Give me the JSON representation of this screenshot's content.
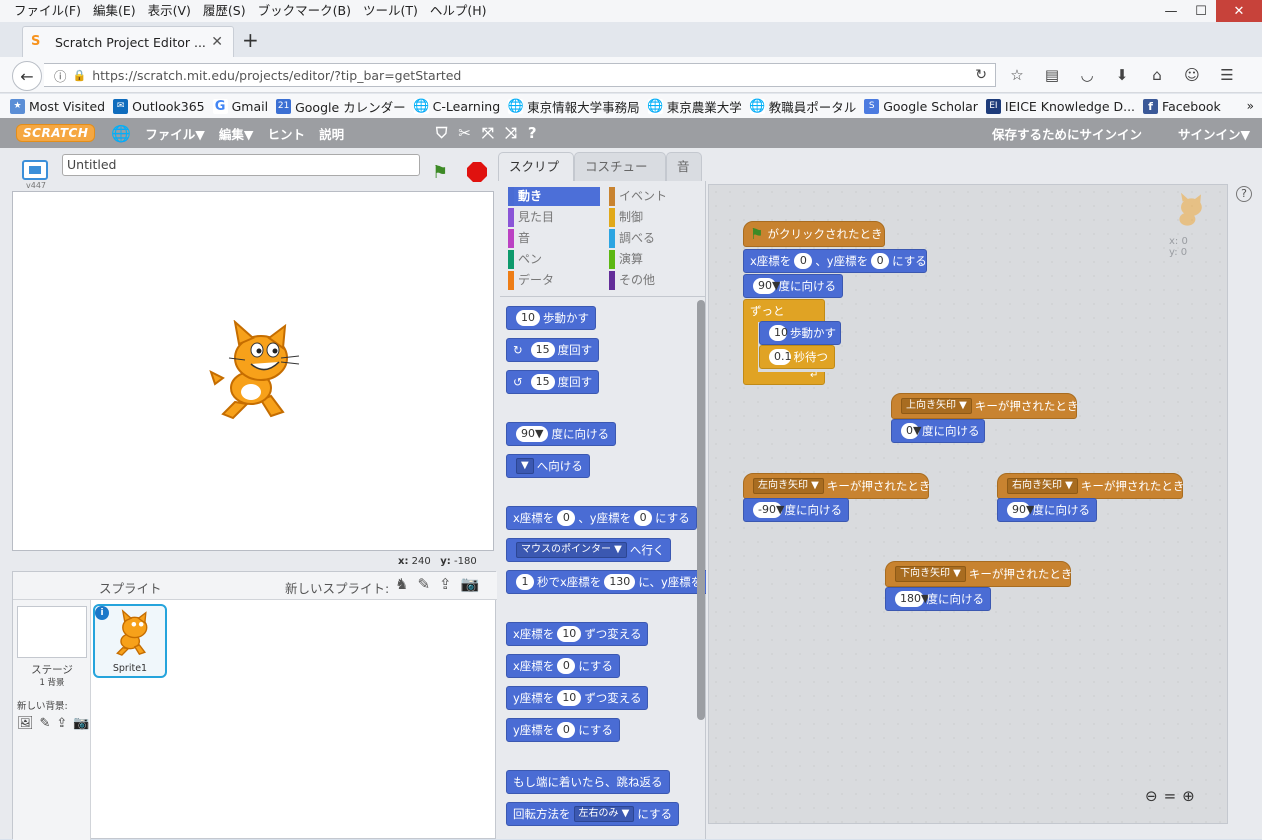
{
  "os_menu": [
    "ファイル(F)",
    "編集(E)",
    "表示(V)",
    "履歴(S)",
    "ブックマーク(B)",
    "ツール(T)",
    "ヘルプ(H)"
  ],
  "browser_tab": {
    "title": "Scratch Project Editor ..."
  },
  "url": "https://scratch.mit.edu/projects/editor/?tip_bar=getStarted",
  "bookmarks": [
    "Most Visited",
    "Outlook365",
    "Gmail",
    "Google カレンダー",
    "C-Learning",
    "東京情報大学事務局",
    "東京農業大学",
    "教職員ポータル",
    "Google Scholar",
    "IEICE Knowledge D...",
    "Facebook"
  ],
  "scratch_bar": {
    "logo": "SCRATCH",
    "menus": [
      "ファイル▼",
      "編集▼",
      "ヒント",
      "説明"
    ],
    "save_label": "保存するためにサインイン",
    "signin_label": "サインイン▼"
  },
  "stage": {
    "project_title": "Untitled",
    "project_version": "v447",
    "coords": {
      "x_label": "x:",
      "x": "240",
      "y_label": "y:",
      "y": "-180"
    }
  },
  "sprites": {
    "header": "スプライト",
    "new_sprite_label": "新しいスプライト:",
    "stage_label": "ステージ",
    "stage_backdrops": "1 背景",
    "new_backdrop_label": "新しい背景:",
    "sprite_name": "Sprite1"
  },
  "tabs": [
    "スクリプト",
    "コスチューム",
    "音"
  ],
  "categories": [
    {
      "label": "動き",
      "color": "#4a6cd4"
    },
    {
      "label": "イベント",
      "color": "#c88330"
    },
    {
      "label": "見た目",
      "color": "#8a55d7"
    },
    {
      "label": "制御",
      "color": "#e1a91a"
    },
    {
      "label": "音",
      "color": "#bb42c3"
    },
    {
      "label": "調べる",
      "color": "#2ca5e2"
    },
    {
      "label": "ペン",
      "color": "#0e9a6c"
    },
    {
      "label": "演算",
      "color": "#5cb712"
    },
    {
      "label": "データ",
      "color": "#ee7d16"
    },
    {
      "label": "その他",
      "color": "#632d99"
    }
  ],
  "palette": {
    "move_steps": {
      "v": "10",
      "t": "歩動かす"
    },
    "turn_right": {
      "v": "15",
      "t": "度回す"
    },
    "turn_left": {
      "v": "15",
      "t": "度回す"
    },
    "point_dir": {
      "v": "90▼",
      "t": "度に向ける"
    },
    "point_toward": {
      "v": "▼",
      "t": "へ向ける"
    },
    "goto_xy": {
      "t1": "x座標を",
      "x": "0",
      "t2": "、y座標を",
      "y": "0",
      "t3": "にする"
    },
    "goto": {
      "v": "マウスのポインター ▼",
      "t": "へ行く"
    },
    "glide": {
      "s": "1",
      "t1": "秒でx座標を",
      "x": "130",
      "t2": "に、y座標を"
    },
    "change_x": {
      "t1": "x座標を",
      "v": "10",
      "t2": "ずつ変える"
    },
    "set_x": {
      "t1": "x座標を",
      "v": "0",
      "t2": "にする"
    },
    "change_y": {
      "t1": "y座標を",
      "v": "10",
      "t2": "ずつ変える"
    },
    "set_y": {
      "t1": "y座標を",
      "v": "0",
      "t2": "にする"
    },
    "bounce": "もし端に着いたら、跳ね返る",
    "rotation": {
      "t1": "回転方法を",
      "v": "左右のみ ▼",
      "t2": "にする"
    }
  },
  "scripts": {
    "flag_hat": "がクリックされたとき",
    "goto_xy": {
      "t1": "x座標を",
      "x": "0",
      "t2": "、y座標を",
      "y": "0",
      "t3": "にする"
    },
    "point90": {
      "v": "90▼",
      "t": "度に向ける"
    },
    "forever": "ずっと",
    "move10": {
      "v": "10",
      "t": "歩動かす"
    },
    "wait": {
      "v": "0.1",
      "t": "秒待つ"
    },
    "key_up": {
      "key": "上向き矢印 ▼",
      "t": "キーが押されたとき",
      "v": "0▼",
      "t2": "度に向ける"
    },
    "key_left": {
      "key": "左向き矢印 ▼",
      "t": "キーが押されたとき",
      "v": "-90▼",
      "t2": "度に向ける"
    },
    "key_right": {
      "key": "右向き矢印 ▼",
      "t": "キーが押されたとき",
      "v": "90▼",
      "t2": "度に向ける"
    },
    "key_down": {
      "key": "下向き矢印 ▼",
      "t": "キーが押されたとき",
      "v": "180▼",
      "t2": "度に向ける"
    },
    "sprite_x": "x: 0",
    "sprite_y": "y: 0"
  }
}
